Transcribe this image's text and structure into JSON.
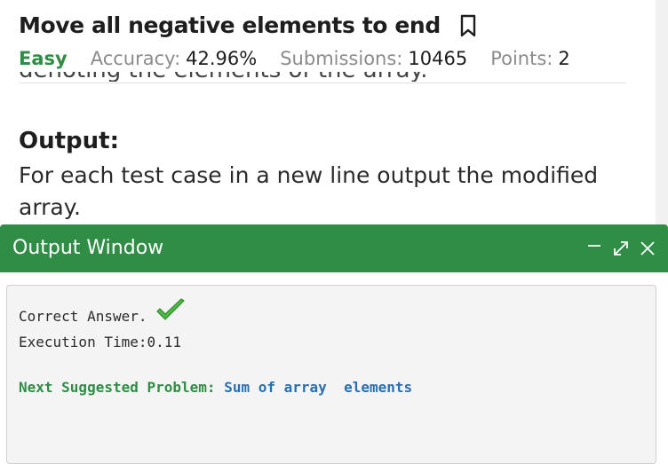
{
  "problem": {
    "title": "Move all negative elements to end",
    "difficulty": "Easy",
    "accuracy_label": "Accuracy:",
    "accuracy_value": "42.96%",
    "submissions_label": "Submissions:",
    "submissions_value": "10465",
    "points_label": "Points:",
    "points_value": "2",
    "cut_off_text": "denoting the elements of the array.",
    "output_heading": "Output:",
    "output_description": "For each test case in a new line output the modified array."
  },
  "output_window": {
    "title": "Output Window",
    "result_text": "Correct Answer.",
    "execution_time": "Execution Time:0.11",
    "next_problem_label": "Next Suggested Problem:",
    "next_problem_link": "Sum of array  elements"
  },
  "colors": {
    "brand_green": "#2f8d46",
    "link_blue": "#2a6fb0"
  }
}
